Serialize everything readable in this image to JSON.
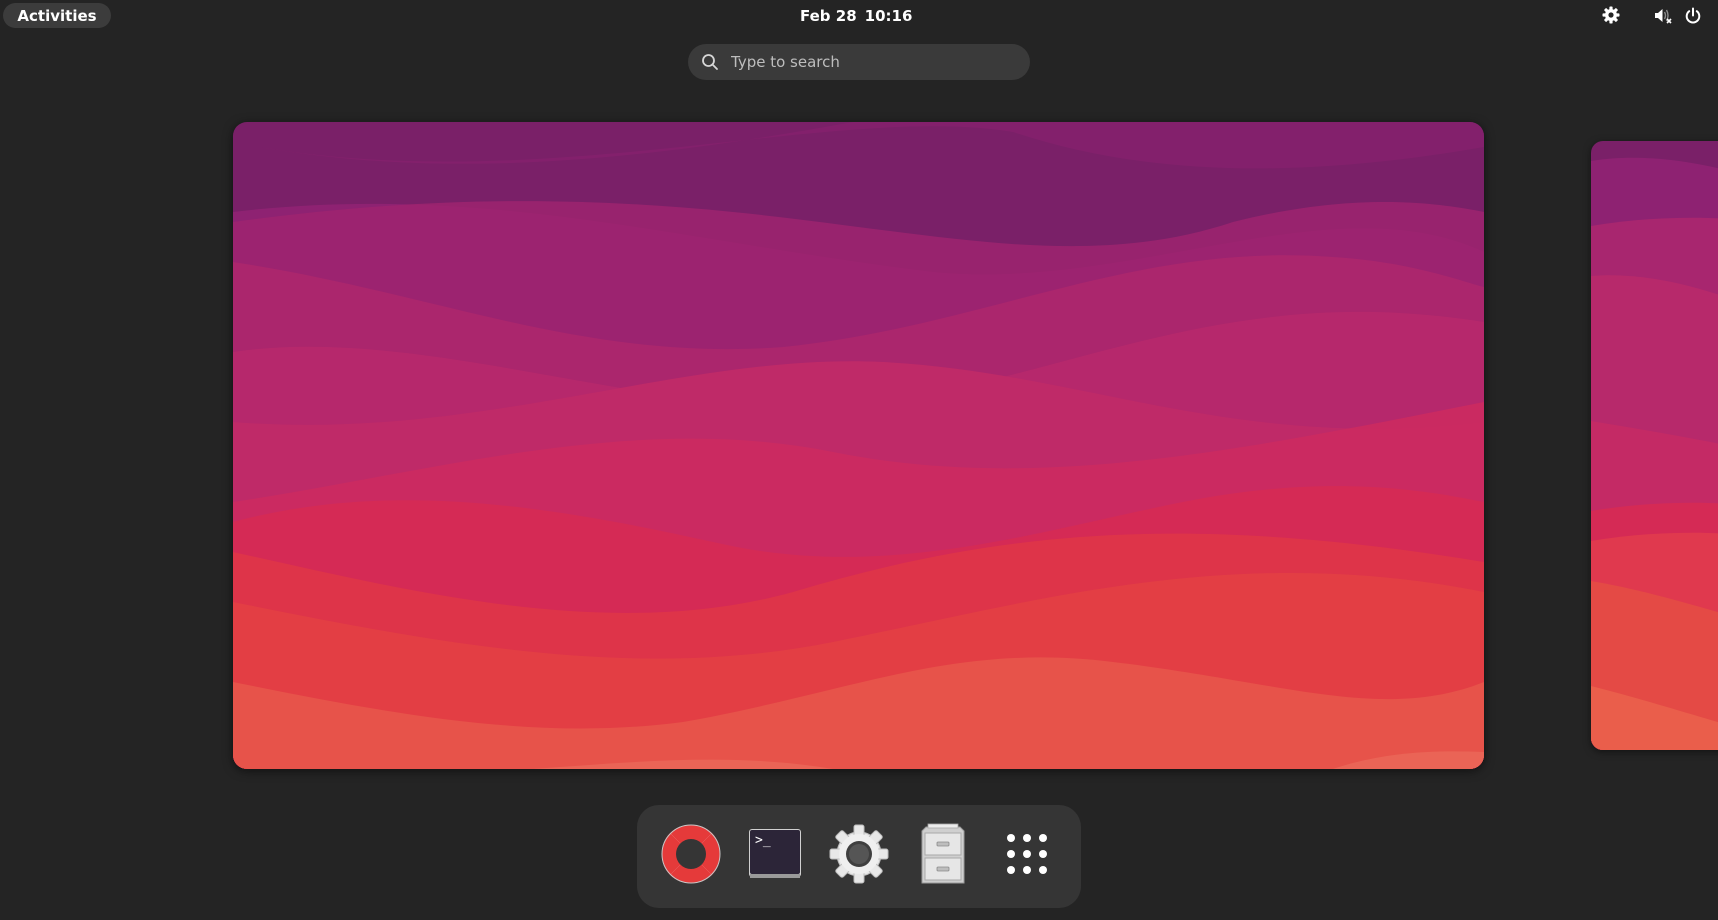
{
  "topbar": {
    "activities_label": "Activities",
    "date": "Feb 28",
    "time": "10:16",
    "tray": {
      "settings_icon": "gear-icon",
      "volume_icon": "volume-muted-icon",
      "power_icon": "power-icon"
    }
  },
  "search": {
    "placeholder": "Type to search",
    "value": "",
    "icon": "search-icon"
  },
  "workspaces": {
    "count_visible": 2,
    "wallpaper_colors": [
      "#7a2068",
      "#8c2270",
      "#a8266f",
      "#bb2a6a",
      "#d32a5c",
      "#e0394e",
      "#e44a45",
      "#ea5e4b"
    ]
  },
  "dock": {
    "items": [
      {
        "name": "Help",
        "icon": "lifebuoy-icon"
      },
      {
        "name": "Terminal",
        "icon": "terminal-icon"
      },
      {
        "name": "Settings",
        "icon": "settings-gear-icon"
      },
      {
        "name": "Files",
        "icon": "file-cabinet-icon"
      },
      {
        "name": "Show Apps",
        "icon": "app-grid-icon"
      }
    ]
  },
  "colors": {
    "background": "#242424",
    "panel": "#3a3a3a",
    "dock": "#353535",
    "text": "#ffffff"
  }
}
